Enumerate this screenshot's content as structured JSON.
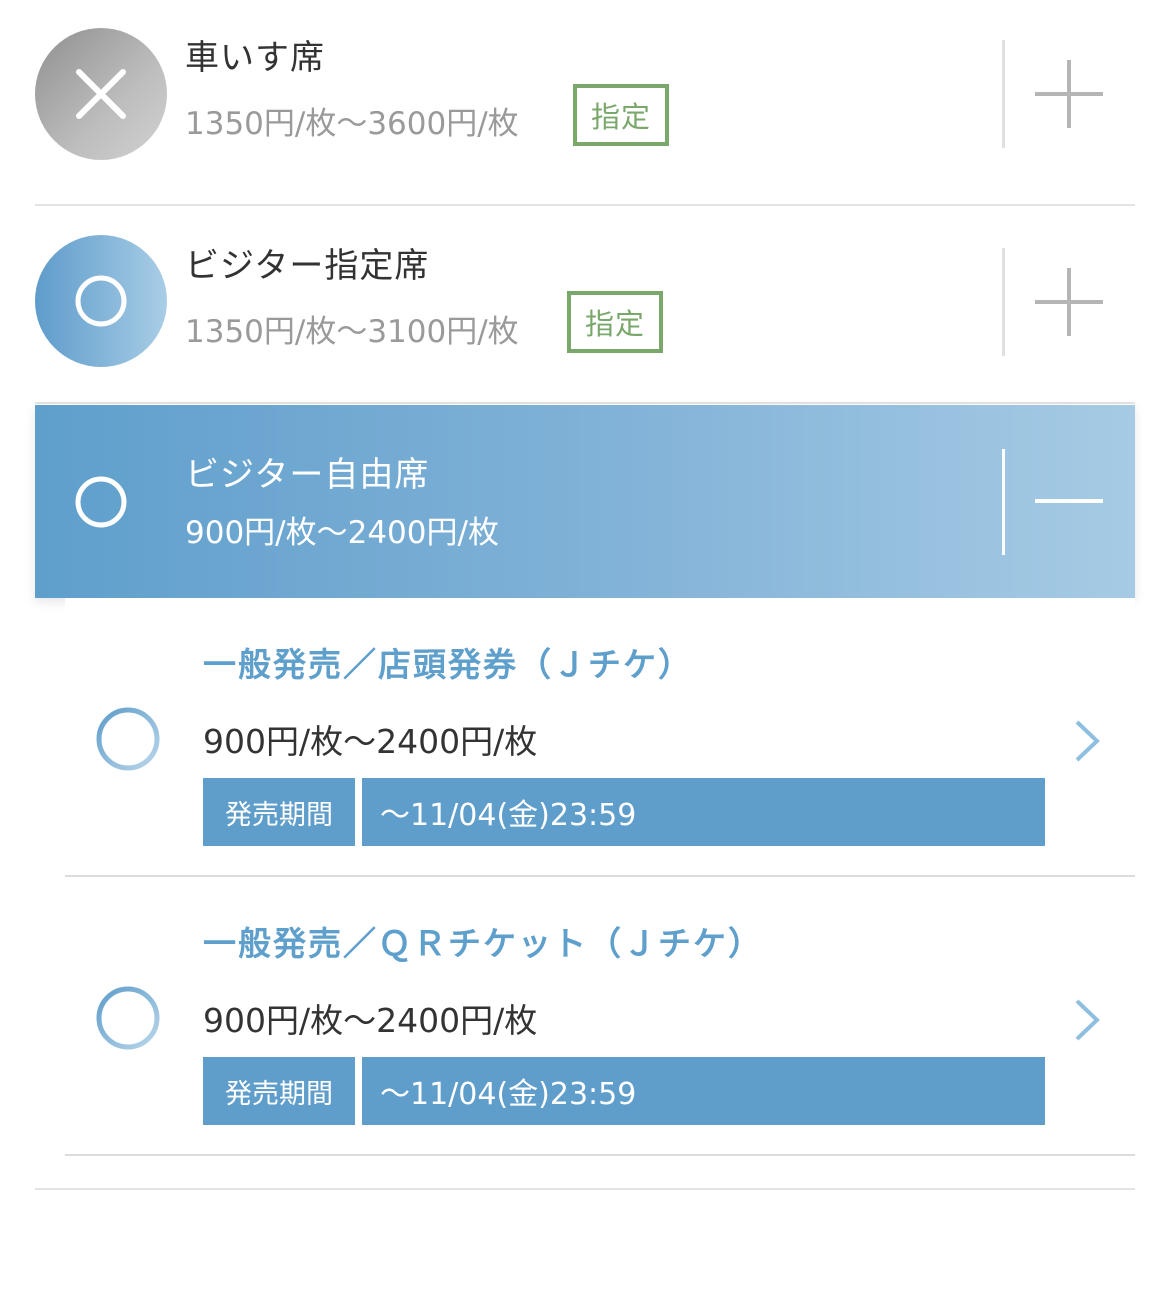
{
  "seats": [
    {
      "name": "車いす席",
      "price": "1350円/枚〜3600円/枚",
      "badge": "指定",
      "status": "x"
    },
    {
      "name": "ビジター指定席",
      "price": "1350円/枚〜3100円/枚",
      "badge": "指定",
      "status": "o"
    },
    {
      "name": "ビジター自由席",
      "price": "900円/枚〜2400円/枚",
      "status": "o",
      "expanded": true
    }
  ],
  "sub_items": [
    {
      "title": "一般発売／店頭発券（Ｊチケ）",
      "price": "900円/枚〜2400円/枚",
      "period_label": "発売期間",
      "period_value": "〜11/04(金)23:59"
    },
    {
      "title": "一般発売／ＱＲチケット（Ｊチケ）",
      "price": "900円/枚〜2400円/枚",
      "period_label": "発売期間",
      "period_value": "〜11/04(金)23:59"
    }
  ],
  "colors": {
    "accent": "#5f9fcc",
    "badge_green": "#7aa86b",
    "muted_text": "#9a9a9a"
  }
}
